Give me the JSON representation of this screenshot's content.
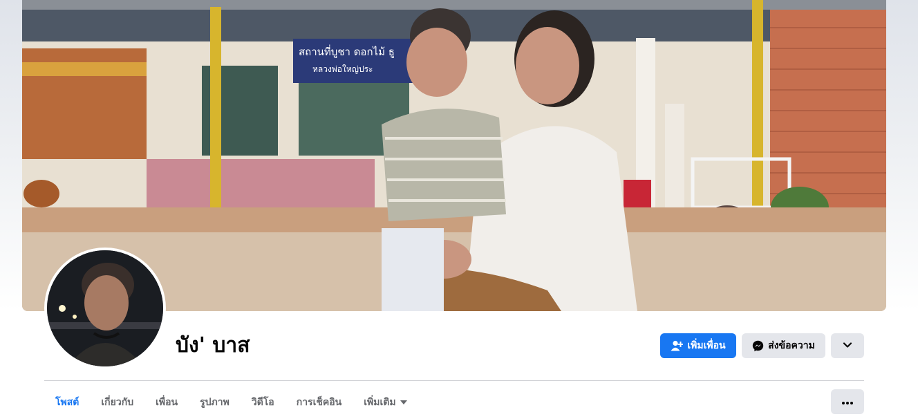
{
  "profile": {
    "name": "บัง' บาส"
  },
  "actions": {
    "add_friend_label": "เพิ่มเพื่อน",
    "message_label": "ส่งข้อความ"
  },
  "cover": {
    "sign_line1": "สถานที่บูชา ดอกไม้ ธู",
    "sign_line2": "หลวงพ่อใหญ่ประ"
  },
  "tabs": [
    {
      "label": "โพสต์",
      "active": true
    },
    {
      "label": "เกี่ยวกับ",
      "active": false
    },
    {
      "label": "เพื่อน",
      "active": false
    },
    {
      "label": "รูปภาพ",
      "active": false
    },
    {
      "label": "วิดีโอ",
      "active": false
    },
    {
      "label": "การเช็คอิน",
      "active": false
    },
    {
      "label": "เพิ่มเติม",
      "active": false
    }
  ],
  "colors": {
    "accent": "#1877f2",
    "secondary_button": "#e4e6eb",
    "text_primary": "#050505",
    "text_secondary": "#65676b"
  },
  "icons": {
    "add_friend": "person-plus-icon",
    "message": "messenger-icon",
    "dropdown": "chevron-down-icon",
    "more_tab": "caret-down-icon",
    "overflow": "more-dots-icon"
  }
}
